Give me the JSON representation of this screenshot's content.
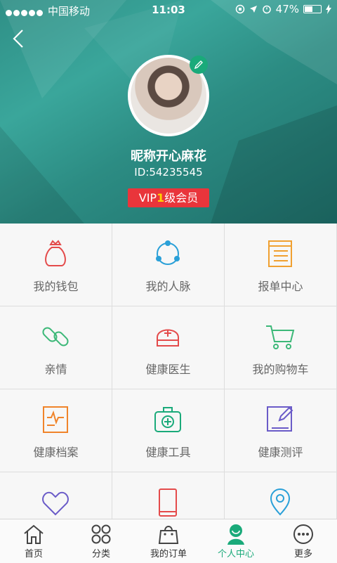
{
  "status_bar": {
    "carrier": "中国移动",
    "time": "11:03",
    "battery": "47%"
  },
  "profile": {
    "nickname": "昵称开心麻花",
    "id": "ID:54235545",
    "vip_prefix": "VIP",
    "vip_level": "1",
    "vip_suffix": "级会员"
  },
  "grid": [
    {
      "label": "我的钱包",
      "icon": "money-bag-icon"
    },
    {
      "label": "我的人脉",
      "icon": "network-icon"
    },
    {
      "label": "报单中心",
      "icon": "list-icon"
    },
    {
      "label": "亲情",
      "icon": "link-icon"
    },
    {
      "label": "健康医生",
      "icon": "nurse-cap-icon"
    },
    {
      "label": "我的购物车",
      "icon": "cart-icon"
    },
    {
      "label": "健康档案",
      "icon": "health-record-icon"
    },
    {
      "label": "健康工具",
      "icon": "medical-kit-icon"
    },
    {
      "label": "健康测评",
      "icon": "evaluation-icon"
    },
    {
      "label": "",
      "icon": "heart-icon"
    },
    {
      "label": "",
      "icon": "phone-icon"
    },
    {
      "label": "",
      "icon": "location-pin-icon"
    }
  ],
  "tabs": [
    {
      "label": "首页",
      "icon": "home-icon"
    },
    {
      "label": "分类",
      "icon": "category-icon"
    },
    {
      "label": "我的订单",
      "icon": "bag-icon"
    },
    {
      "label": "个人中心",
      "icon": "person-icon",
      "active": true
    },
    {
      "label": "更多",
      "icon": "more-icon"
    }
  ],
  "colors": {
    "accent": "#1aaa7a",
    "vip_badge": "#e9353b",
    "vip_level": "#ffd200"
  }
}
